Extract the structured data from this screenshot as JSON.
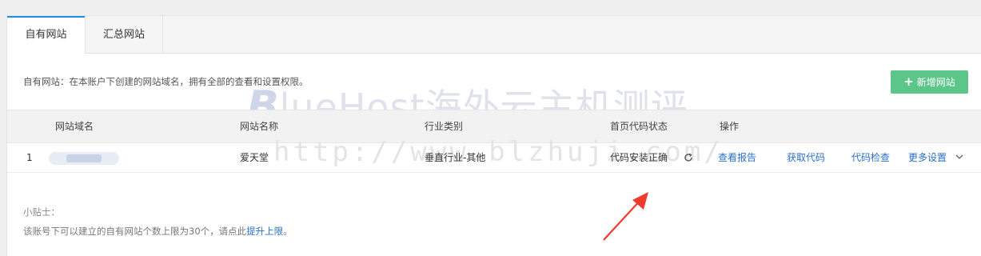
{
  "tabs": [
    {
      "label": "自有网站"
    },
    {
      "label": "汇总网站"
    }
  ],
  "description": "自有网站：在本账户下创建的网站域名，拥有全部的查看和设置权限。",
  "add_button": {
    "icon": "+",
    "label": "新增网站"
  },
  "table": {
    "headers": [
      "网站域名",
      "网站名称",
      "行业类别",
      "首页代码状态",
      "操作"
    ],
    "rows": [
      {
        "index": "1",
        "name": "爱天堂",
        "category": "垂直行业-其他",
        "code_status": "代码安装正确",
        "actions": [
          "查看报告",
          "获取代码",
          "代码检查",
          "更多设置"
        ]
      }
    ]
  },
  "tips": {
    "title": "小贴士：",
    "text": "该账号下可以建立的自有网站个数上限为30个，请点此",
    "link": "提升上限",
    "end": "。"
  },
  "watermark": {
    "logo_letter": "B",
    "text": "lueHost海外云主机测评",
    "url": "http://www.blzhuji.com/"
  },
  "colors": {
    "tab_accent": "#1e8fe1",
    "add_button": "#5cc68a",
    "link": "#2a6fc9",
    "annotation_arrow": "#f03a2e"
  }
}
